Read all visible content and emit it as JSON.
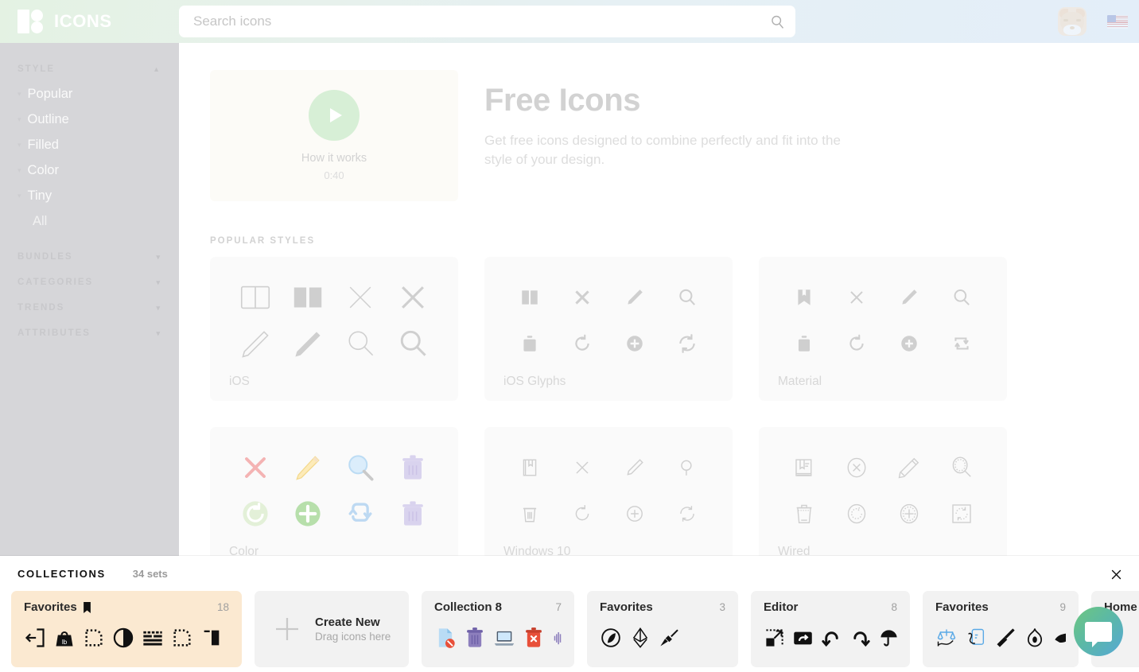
{
  "header": {
    "brand": "ICONS",
    "logo_icon": "icons8-logo",
    "search": {
      "placeholder": "Search icons",
      "value": "",
      "icon": "search-icon"
    },
    "avatar_icon": "fox-avatar",
    "language_icon": "us-flag-icon"
  },
  "sidebar": {
    "sections": [
      {
        "label": "STYLE",
        "caret": "▲",
        "expanded": true,
        "items": [
          {
            "label": "Popular",
            "caret": "▾"
          },
          {
            "label": "Outline",
            "caret": "▾"
          },
          {
            "label": "Filled",
            "caret": "▾"
          },
          {
            "label": "Color",
            "caret": "▾"
          },
          {
            "label": "Tiny",
            "caret": "▾"
          },
          {
            "label": "All",
            "caret": ""
          }
        ]
      },
      {
        "label": "BUNDLES",
        "caret": "▾",
        "expanded": false,
        "items": []
      },
      {
        "label": "CATEGORIES",
        "caret": "▾",
        "expanded": false,
        "items": []
      },
      {
        "label": "TRENDS",
        "caret": "▾",
        "expanded": false,
        "items": []
      },
      {
        "label": "ATTRIBUTES",
        "caret": "▾",
        "expanded": false,
        "items": []
      }
    ]
  },
  "main": {
    "video": {
      "title": "How it works",
      "duration": "0:40",
      "play_icon": "play-icon"
    },
    "hero": {
      "title": "Free Icons",
      "subtitle": "Get free icons designed to combine perfectly and fit into the style of your design."
    },
    "popular_styles_label": "POPULAR STYLES",
    "style_cards": [
      {
        "name": "iOS",
        "icons": [
          "book-outline-icon",
          "book-filled-icon",
          "close-thin-icon",
          "close-bold-icon",
          "pencil-outline-icon",
          "pencil-filled-icon",
          "search-thin-icon",
          "search-bold-icon"
        ]
      },
      {
        "name": "iOS Glyphs",
        "icons": [
          "book-glyph-icon",
          "close-glyph-icon",
          "pencil-glyph-icon",
          "search-glyph-icon",
          "trash-glyph-icon",
          "refresh-glyph-icon",
          "plus-circle-glyph-icon",
          "sync-glyph-icon"
        ]
      },
      {
        "name": "Material",
        "icons": [
          "bookmark-icon",
          "close-icon",
          "pencil-icon",
          "search-icon",
          "trash-icon",
          "refresh-icon",
          "plus-circle-icon",
          "repeat-icon"
        ]
      },
      {
        "name": "Color",
        "icons": [
          "close-color-icon",
          "pencil-color-icon",
          "search-color-icon",
          "trash-color-icon",
          "refresh-color-icon",
          "plus-color-icon",
          "sync-color-icon",
          "trash-color2-icon"
        ]
      },
      {
        "name": "Windows 10",
        "icons": [
          "book-win-icon",
          "close-win-icon",
          "pencil-win-icon",
          "search-win-icon",
          "trash-win-icon",
          "refresh-win-icon",
          "plus-circle-win-icon",
          "sync-win-icon"
        ]
      },
      {
        "name": "Wired",
        "icons": [
          "book-wired-icon",
          "close-wired-icon",
          "pencil-wired-icon",
          "search-wired-icon",
          "trash-wired-icon",
          "refresh-wired-icon",
          "plus-wired-icon",
          "sync-wired-icon"
        ]
      }
    ]
  },
  "collections": {
    "title": "COLLECTIONS",
    "count_label": "34 sets",
    "close_icon": "close-icon",
    "create": {
      "title": "Create New",
      "subtitle": "Drag icons here",
      "icon": "plus-icon"
    },
    "cards": [
      {
        "name": "Favorites",
        "count": "18",
        "pinned": true,
        "active": true
      },
      {
        "name": "Collection 8",
        "count": "7",
        "pinned": false,
        "active": false
      },
      {
        "name": "Favorites",
        "count": "3",
        "pinned": false,
        "active": false
      },
      {
        "name": "Editor",
        "count": "8",
        "pinned": false,
        "active": false
      },
      {
        "name": "Favorites",
        "count": "9",
        "pinned": false,
        "active": false
      },
      {
        "name": "Home",
        "count": "",
        "pinned": false,
        "active": false
      }
    ]
  },
  "chat": {
    "icon": "chat-bubble-icon"
  },
  "colors": {
    "header_gradient_start": "#e4f2e3",
    "header_gradient_end": "#e3eef9",
    "sidebar_bg": "#d6d6d9",
    "card_bg": "#fafafa",
    "favorite_card_bg": "#fbe9d1",
    "play_circle": "#d7efd6",
    "fab_gradient_start": "#6ec77f",
    "fab_gradient_end": "#55a8d6"
  }
}
